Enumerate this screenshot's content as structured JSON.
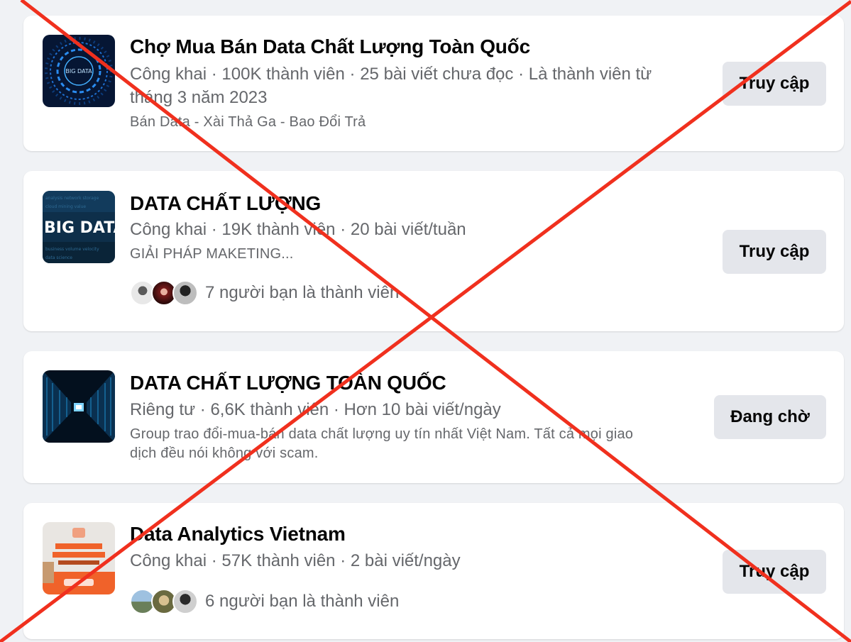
{
  "groups": [
    {
      "name": "Chợ Mua Bán Data Chất Lượng Toàn Quốc",
      "meta_line1": "Công khai · 100K thành viên · 25 bài viết chưa đọc · Là thành viên từ",
      "meta_line2": "tháng 3 năm 2023",
      "description": "Bán Data - Xài Thả Ga - Bao Đổi Trả",
      "thumbnail_text": "BIG DATA",
      "button": "Truy cập"
    },
    {
      "name": "DATA CHẤT LƯỢNG",
      "meta_line1": "Công khai · 19K thành viên · 20 bài viết/tuần",
      "description": "GIẢI PHÁP MAKETING...",
      "thumbnail_text": "BIG DATA",
      "friends": "7 người bạn là thành viên",
      "button": "Truy cập"
    },
    {
      "name": "DATA CHẤT LƯỢNG TOÀN QUỐC",
      "meta_line1": "Riêng tư · 6,6K thành viên · Hơn 10 bài viết/ngày",
      "description_line1": "Group trao đổi-mua-bán data chất lượng uy tín nhất Việt Nam. Tất cả mọi giao",
      "description_line2": "dịch đều nói không với scam.",
      "button": "Đang chờ"
    },
    {
      "name": "Data Analytics Vietnam",
      "meta_line1": "Công khai · 57K thành viên · 2 bài viết/ngày",
      "friends": "6 người bạn là thành viên",
      "button": "Truy cập"
    }
  ],
  "colors": {
    "page_bg": "#f0f2f5",
    "card_bg": "#ffffff",
    "button_bg": "#e4e6eb",
    "secondary_text": "#65676b",
    "cross_overlay": "#f0301e"
  }
}
